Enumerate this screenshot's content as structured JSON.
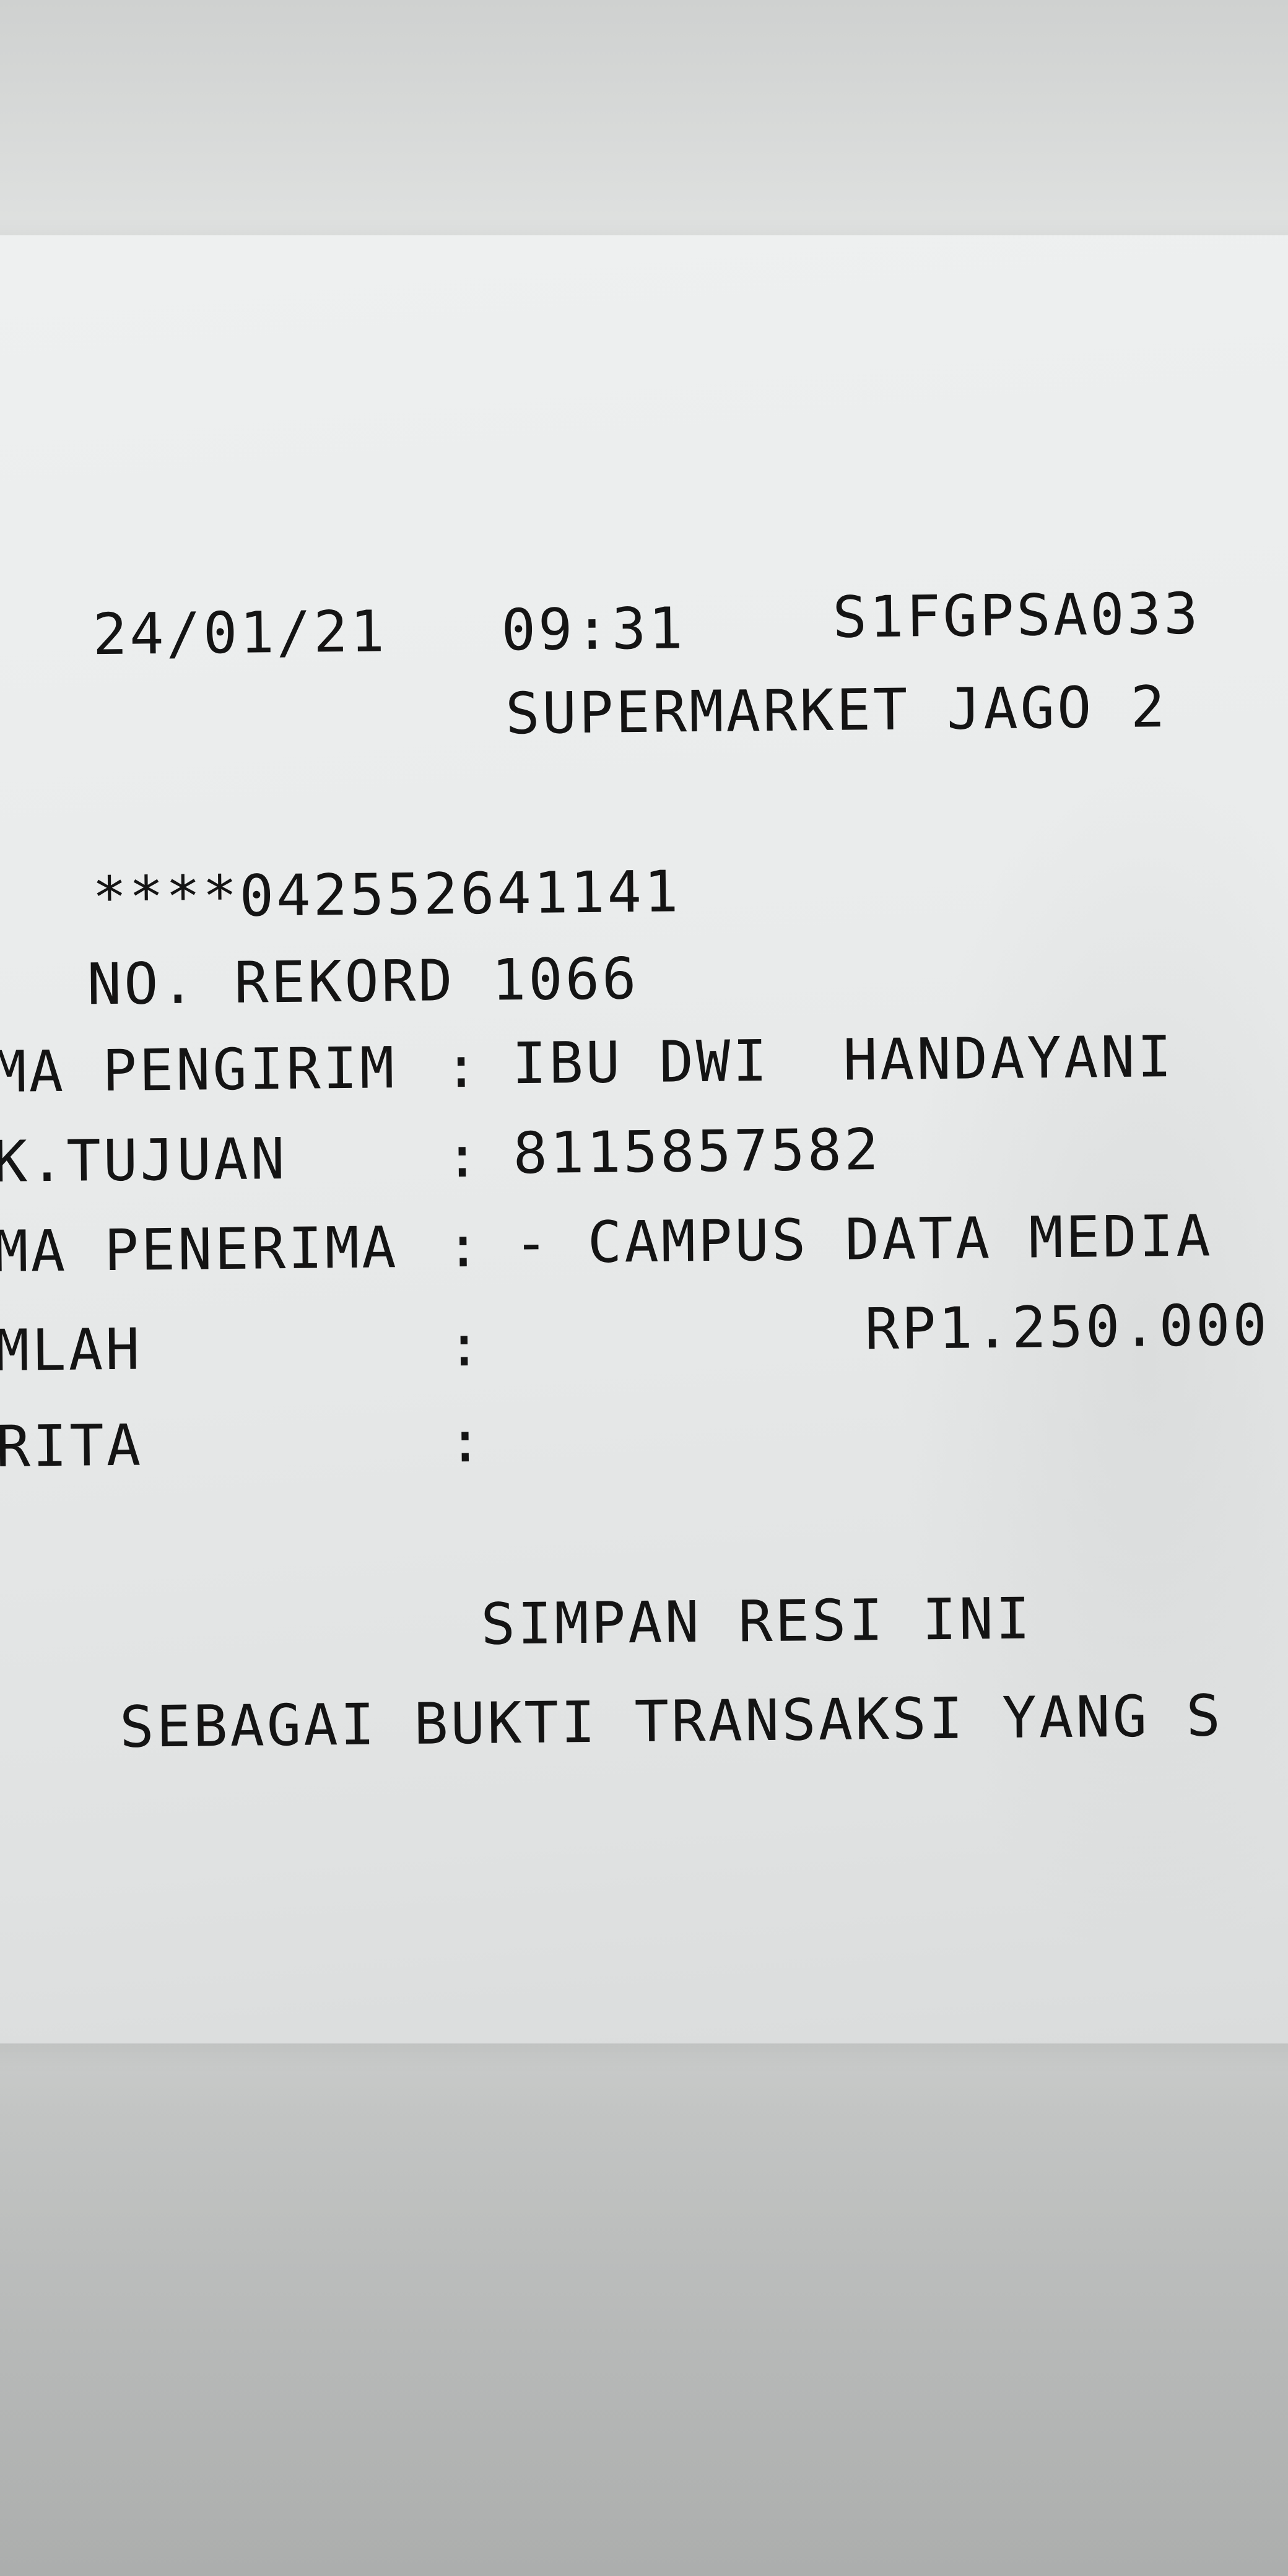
{
  "receipt": {
    "date": "24/01/21",
    "time": "09:31",
    "terminal_id": "S1FGPSA033",
    "merchant": "SUPERMARKET JAGO 2",
    "card_number": "****042552641141",
    "record_line": "NO. REKORD 1066",
    "sender_label": "MA PENGIRIM",
    "sender_sep": ":",
    "sender_value": "IBU DWI  HANDAYANI",
    "account_label": "K.TUJUAN",
    "account_sep": ":",
    "account_value": "8115857582",
    "recipient_label": "MA PENERIMA",
    "recipient_sep": ":",
    "recipient_value": "- CAMPUS DATA MEDIA",
    "amount_label": "MLAH",
    "amount_sep": ":",
    "amount_value": "RP1.250.000",
    "note_label": "RITA",
    "note_sep": ":",
    "footer_line1": "SIMPAN RESI INI",
    "footer_line2": "SEBAGAI BUKTI TRANSAKSI YANG S"
  }
}
